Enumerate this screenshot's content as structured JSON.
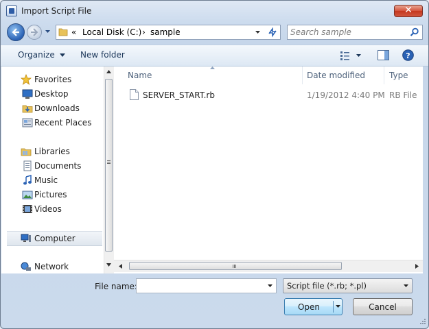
{
  "window": {
    "title": "Import Script File",
    "close_glyph": "✕"
  },
  "nav": {
    "breadcrumb": [
      "«",
      "Local Disk (C:)",
      "›",
      "sample"
    ],
    "search_placeholder": "Search sample"
  },
  "toolbar": {
    "organize_label": "Organize",
    "new_folder_label": "New folder"
  },
  "sidebar": {
    "favorites": {
      "label": "Favorites",
      "items": [
        "Desktop",
        "Downloads",
        "Recent Places"
      ]
    },
    "libraries": {
      "label": "Libraries",
      "items": [
        "Documents",
        "Music",
        "Pictures",
        "Videos"
      ]
    },
    "computer": {
      "label": "Computer",
      "selected": true
    },
    "network": {
      "label": "Network"
    }
  },
  "file_list": {
    "columns": [
      "Name",
      "Date modified",
      "Type"
    ],
    "rows": [
      {
        "name": "SERVER_START.rb",
        "date": "1/19/2012 4:40 PM",
        "type": "RB File"
      }
    ]
  },
  "footer": {
    "file_name_label": "File name:",
    "file_name_value": "",
    "filter_value": "Script file (*.rb; *.pl)",
    "open_label": "Open",
    "cancel_label": "Cancel"
  },
  "colors": {
    "accent": "#2a62b5",
    "close": "#c5381f",
    "header_text": "#4c607a"
  }
}
